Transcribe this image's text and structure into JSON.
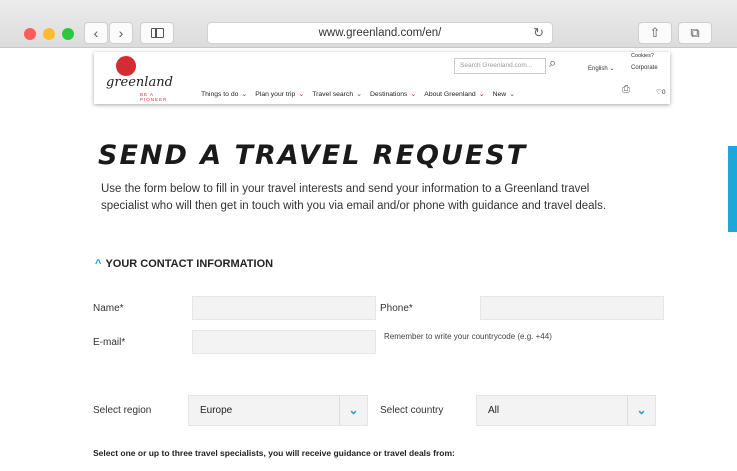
{
  "browser": {
    "url": "www.greenland.com/en/",
    "back_icon": "‹",
    "forward_icon": "›",
    "reload_icon": "↻",
    "share_icon": "⇧",
    "tabs_icon": "⧉"
  },
  "header": {
    "logo_word": "greenland",
    "logo_tag": "BE A PIONEER",
    "search_placeholder": "Search Greenland.com...",
    "language": "English",
    "cookies": "Cookies?",
    "corporate": "Corporate",
    "menu": [
      {
        "label": "Things to do"
      },
      {
        "label": "Plan your trip"
      },
      {
        "label": "Travel search"
      },
      {
        "label": "Destinations"
      },
      {
        "label": "About Greenland"
      },
      {
        "label": "New"
      }
    ],
    "cart_count": "0"
  },
  "main": {
    "title": "SEND A TRAVEL REQUEST",
    "intro": "Use the form below to fill in your travel interests and send your information to a Greenland travel specialist who will then get in touch with you via email and/or phone with guidance and travel deals.",
    "section_title": "YOUR CONTACT INFORMATION",
    "fields": {
      "name_label": "Name*",
      "phone_label": "Phone*",
      "email_label": "E-mail*",
      "phone_hint": "Remember to write your countrycode (e.g. +44)"
    },
    "region_label": "Select region",
    "region_value": "Europe",
    "country_label": "Select country",
    "country_value": "All",
    "specialists_text": "Select one or up to three travel specialists, you will receive guidance or travel deals from:"
  },
  "colors": {
    "accent": "#1a9fce",
    "brand_red": "#d42c33"
  }
}
